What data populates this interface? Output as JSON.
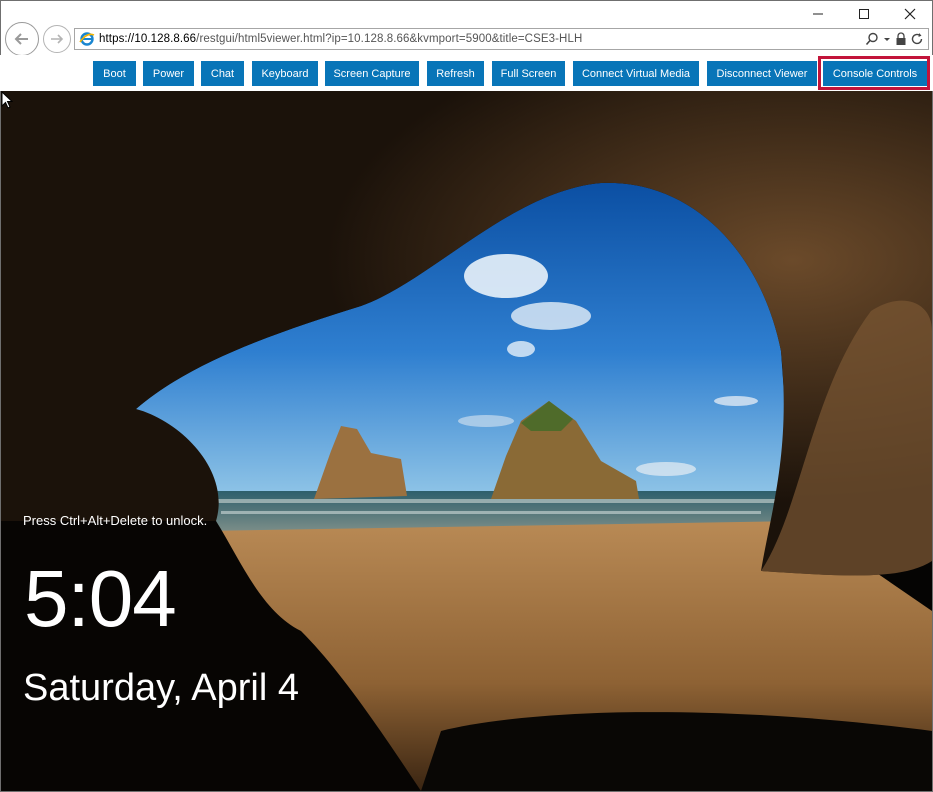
{
  "browser": {
    "url_host": "https://10.128.8.66",
    "url_path": "/restgui/html5viewer.html?ip=10.128.8.66&kvmport=5900&title=CSE3-HLH"
  },
  "toolbar": {
    "buttons": [
      "Boot",
      "Power",
      "Chat",
      "Keyboard",
      "Screen Capture",
      "Refresh",
      "Full Screen",
      "Connect Virtual Media",
      "Disconnect Viewer",
      "Console Controls"
    ],
    "highlighted": "Console Controls",
    "accent_color": "#0875b8",
    "highlight_color": "#c2143a"
  },
  "lockscreen": {
    "hint": "Press Ctrl+Alt+Delete to unlock.",
    "time": "5:04",
    "date": "Saturday, April 4"
  }
}
